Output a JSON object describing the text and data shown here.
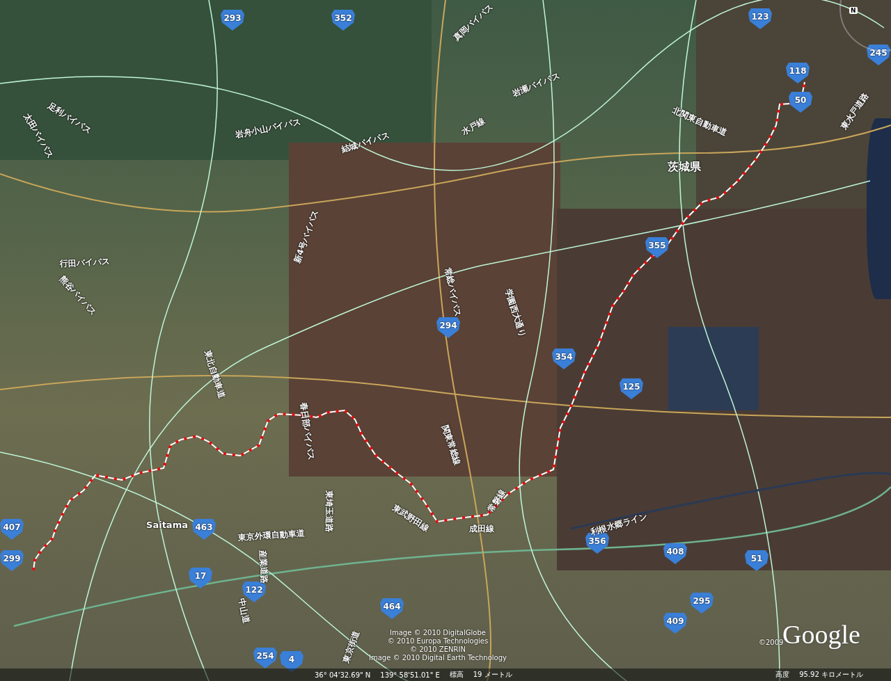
{
  "map": {
    "shields": [
      {
        "number": "293"
      },
      {
        "number": "352"
      },
      {
        "number": "123"
      },
      {
        "number": "245"
      },
      {
        "number": "118"
      },
      {
        "number": "50"
      },
      {
        "number": "355"
      },
      {
        "number": "294"
      },
      {
        "number": "354"
      },
      {
        "number": "125"
      },
      {
        "number": "407"
      },
      {
        "number": "299"
      },
      {
        "number": "463"
      },
      {
        "number": "17"
      },
      {
        "number": "122"
      },
      {
        "number": "464"
      },
      {
        "number": "356"
      },
      {
        "number": "408"
      },
      {
        "number": "51"
      },
      {
        "number": "295"
      },
      {
        "number": "409"
      },
      {
        "number": "254"
      },
      {
        "number": "4"
      }
    ],
    "labels": [
      {
        "kind": "road",
        "text": "太田バイパス"
      },
      {
        "kind": "road",
        "text": "足利バイパス"
      },
      {
        "kind": "road",
        "text": "岩舟小山バイパス"
      },
      {
        "kind": "road",
        "text": "結城バイパス"
      },
      {
        "kind": "road",
        "text": "新4号バイパス"
      },
      {
        "kind": "road",
        "text": "行田バイパス"
      },
      {
        "kind": "road",
        "text": "熊谷バイパス"
      },
      {
        "kind": "road",
        "text": "真岡バイパス"
      },
      {
        "kind": "road",
        "text": "岩瀬バイパス"
      },
      {
        "kind": "road",
        "text": "水戸線"
      },
      {
        "kind": "road",
        "text": "北関東自動車道"
      },
      {
        "kind": "prefecture",
        "text": "茨城県"
      },
      {
        "kind": "road",
        "text": "東水戸道路"
      },
      {
        "kind": "road",
        "text": "常総バイパス"
      },
      {
        "kind": "road",
        "text": "学園西大通り"
      },
      {
        "kind": "road",
        "text": "東北自動車道"
      },
      {
        "kind": "road",
        "text": "春日部バイパス"
      },
      {
        "kind": "road",
        "text": "東埼玉道路"
      },
      {
        "kind": "road",
        "text": "関東常総線"
      },
      {
        "kind": "road",
        "text": "東武野田線"
      },
      {
        "kind": "road",
        "text": "常磐線"
      },
      {
        "kind": "road",
        "text": "成田線"
      },
      {
        "kind": "city",
        "text": "Saitama"
      },
      {
        "kind": "road",
        "text": "東京外環自動車道"
      },
      {
        "kind": "road",
        "text": "産業道路"
      },
      {
        "kind": "road",
        "text": "利根水郷ライン"
      },
      {
        "kind": "road",
        "text": "中山道"
      },
      {
        "kind": "road",
        "text": "東京街道"
      }
    ]
  },
  "compass": "N",
  "attribution": [
    "Image © 2010 DigitalGlobe",
    "© 2010 Europa Technologies",
    "© 2010 ZENRIN",
    "Image © 2010 Digital Earth Technology"
  ],
  "copyright_year": "©2009",
  "logo": "Google",
  "status_bar": {
    "latitude": "36° 04'32.69\" N",
    "longitude": "139° 58'51.01\" E",
    "elevation_label": "標高",
    "elevation": "19 メートル",
    "altitude_label": "高度",
    "altitude": "95.92 キロメートル"
  }
}
